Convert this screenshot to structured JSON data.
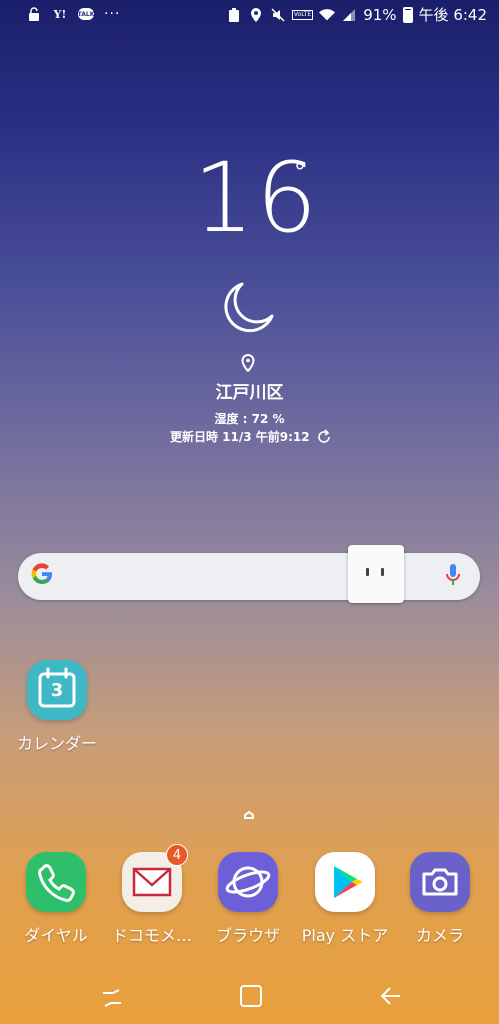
{
  "status_bar": {
    "icons_left": [
      "lock-icon",
      "yahoo-japan-icon",
      "talk-icon",
      "more-dots-icon"
    ],
    "yahoo_text": "Y!",
    "talk_text": "TALK",
    "more_text": "···",
    "volte_text": "VoLTE",
    "battery_percent": "91%",
    "time": "午後 6:42"
  },
  "weather": {
    "temperature": "16",
    "degree": "°",
    "condition_icon": "crescent-moon-icon",
    "location": "江戸川区",
    "humidity": "湿度 : 72 %",
    "updated": "更新日時 11/3 午前9:12"
  },
  "search": {
    "engine": "Google"
  },
  "desktop_apps": [
    {
      "label": "カレンダー",
      "icon": "calendar-icon",
      "date": "3",
      "color": "#3fb8c5"
    }
  ],
  "dock_apps": [
    {
      "label": "ダイヤル",
      "icon": "phone-icon",
      "color": "#2dbf6a"
    },
    {
      "label": "ドコモメ…",
      "icon": "docomo-mail-icon",
      "color": "#f4efe6",
      "badge": "4"
    },
    {
      "label": "ブラウザ",
      "icon": "internet-browser-icon",
      "color": "#6c5fd8"
    },
    {
      "label": "Play ストア",
      "icon": "play-store-icon",
      "color": "#ffffff"
    },
    {
      "label": "カメラ",
      "icon": "camera-icon",
      "color": "#6a62c8"
    }
  ],
  "colors": {
    "badge": "#e8592a",
    "search_bar": "#eeeff3"
  }
}
